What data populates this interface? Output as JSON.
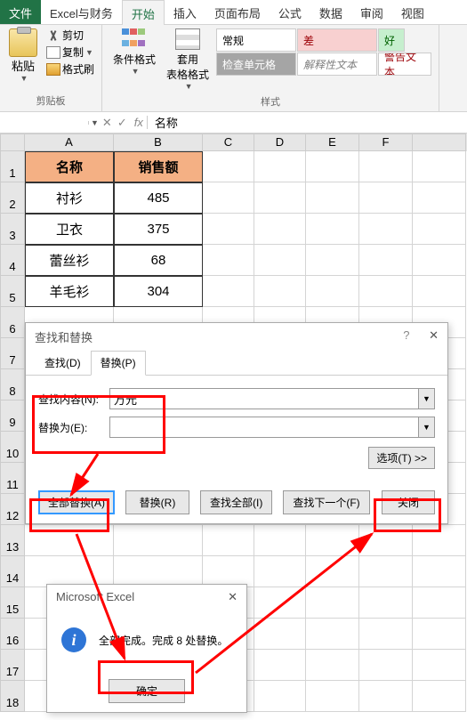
{
  "tabs": {
    "file": "文件",
    "custom": "Excel与财务",
    "home": "开始",
    "insert": "插入",
    "layout": "页面布局",
    "formulas": "公式",
    "data": "数据",
    "review": "审阅",
    "view": "视图"
  },
  "ribbon": {
    "clipboard": {
      "paste": "粘贴",
      "cut": "剪切",
      "copy": "复制",
      "format_painter": "格式刷",
      "label": "剪贴板"
    },
    "cond_format": "条件格式",
    "table_format": "套用\n表格格式",
    "styles": {
      "normal": "常规",
      "bad": "差",
      "good": "好",
      "check": "检查单元格",
      "explanatory": "解释性文本",
      "warning": "警告文本",
      "label": "样式"
    }
  },
  "name_box": "",
  "formula_text": "名称",
  "columns": [
    "A",
    "B",
    "C",
    "D",
    "E",
    "F"
  ],
  "rows": [
    "1",
    "2",
    "3",
    "4",
    "5",
    "6",
    "7",
    "8",
    "9",
    "10",
    "11",
    "12",
    "13",
    "14",
    "15",
    "16",
    "17",
    "18"
  ],
  "table": {
    "headers": [
      "名称",
      "销售额"
    ],
    "data": [
      [
        "衬衫",
        "485"
      ],
      [
        "卫衣",
        "375"
      ],
      [
        "蕾丝衫",
        "68"
      ],
      [
        "羊毛衫",
        "304"
      ]
    ]
  },
  "find_replace": {
    "title": "查找和替换",
    "help": "?",
    "tab_find": "查找(D)",
    "tab_replace": "替换(P)",
    "find_label": "查找内容(N):",
    "find_value": "万元",
    "replace_label": "替换为(E):",
    "replace_value": "",
    "options": "选项(T) >>",
    "replace_all": "全部替换(A)",
    "replace_one": "替换(R)",
    "find_all": "查找全部(I)",
    "find_next": "查找下一个(F)",
    "close": "关闭"
  },
  "msgbox": {
    "title": "Microsoft Excel",
    "message": "全部完成。完成 8 处替换。",
    "ok": "确定"
  }
}
